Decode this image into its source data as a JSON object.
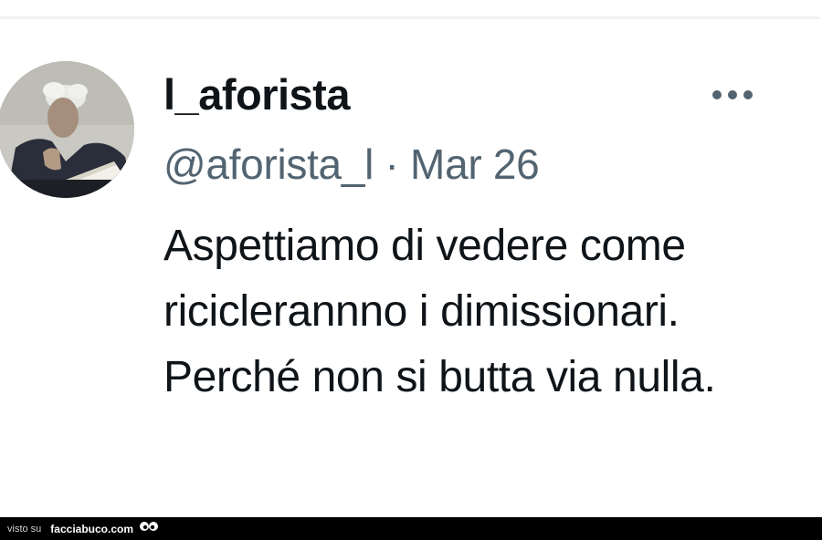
{
  "tweet": {
    "display_name": "l_aforista",
    "handle": "@aforista_l",
    "separator": "·",
    "date": "Mar 26",
    "text": "Aspettiamo di vedere come riciclerann­no i dimissionari. Perché non si butta via nulla."
  },
  "footer": {
    "prefix": "visto su",
    "site": "facciabuco.com"
  },
  "colors": {
    "primary_text": "#0f1419",
    "secondary_text": "#536471",
    "footer_bg": "#000000"
  },
  "icons": {
    "more": "more-horizontal-icon",
    "logo": "eyes-logo-icon"
  }
}
